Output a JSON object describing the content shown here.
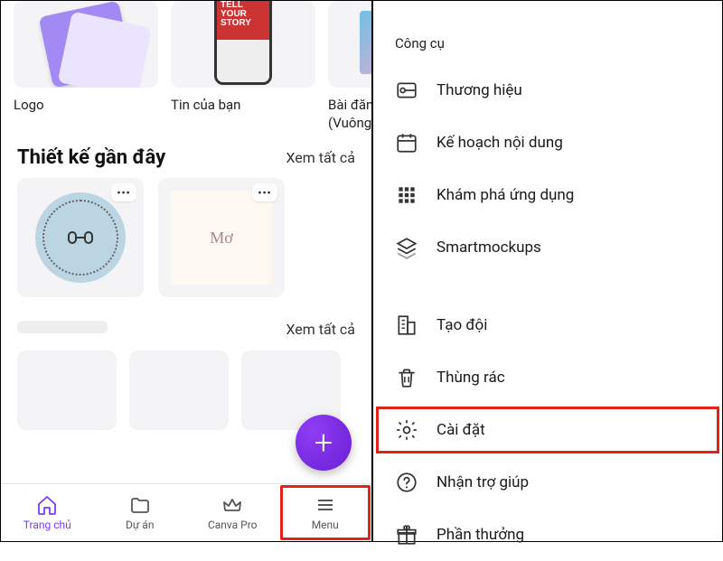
{
  "templates": {
    "items": [
      {
        "label": "Logo"
      },
      {
        "label": "Tin của bạn",
        "phone_text": "TELL\nYOUR\nSTORY"
      },
      {
        "label": "Bài đăng I\n(Vuông)"
      }
    ]
  },
  "recent": {
    "title": "Thiết kế gần đây",
    "see_all": "Xem tất cả",
    "card2_text": "Mơ"
  },
  "blank": {
    "see_all": "Xem tất cả"
  },
  "fab": {
    "label": "+"
  },
  "nav": {
    "home": "Trang chủ",
    "projects": "Dự án",
    "pro": "Canva Pro",
    "menu": "Menu"
  },
  "right_panel": {
    "section1_title": "Công cụ",
    "brand": "Thương hiệu",
    "content_plan": "Kế hoạch nội dung",
    "discover_apps": "Khám phá ứng dụng",
    "smartmockups": "Smartmockups",
    "create_team": "Tạo đội",
    "trash": "Thùng rác",
    "settings": "Cài đặt",
    "help": "Nhận trợ giúp",
    "rewards": "Phần thưởng"
  },
  "highlight_color": "#e2231a",
  "accent_color": "#7a3df5"
}
